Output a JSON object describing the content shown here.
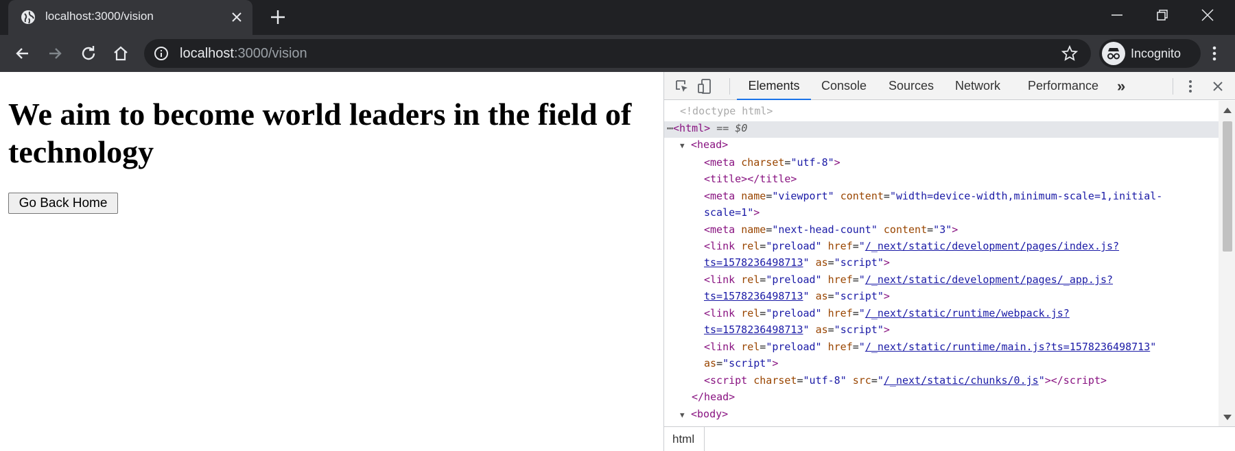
{
  "browser": {
    "tab_title": "localhost:3000/vision",
    "url_host": "localhost",
    "url_rest": ":3000/vision",
    "profile_label": "Incognito",
    "icons": [
      "globe-icon",
      "close-icon",
      "plus-icon",
      "minimize-icon",
      "maximize-icon",
      "window-close-icon",
      "back-arrow-icon",
      "forward-arrow-icon",
      "reload-icon",
      "home-icon",
      "info-icon",
      "star-icon",
      "incognito-icon",
      "kebab-menu-icon"
    ]
  },
  "page": {
    "heading": "We aim to become world leaders in the field of technology",
    "button_label": "Go Back Home"
  },
  "devtools": {
    "tabs": [
      "Elements",
      "Console",
      "Sources",
      "Network",
      "Performance"
    ],
    "active_tab": "Elements",
    "more_tabs": "»",
    "dom": {
      "doctype": "<!doctype html>",
      "html_selected_suffix": "== $0",
      "meta_charset_value": "utf-8",
      "viewport_content_1": "width=device-width,minimum-scale=1,initial-",
      "viewport_content_2": "scale=1",
      "next_head_count": "3",
      "links": [
        {
          "href_1": "/_next/static/development/pages/index.js?",
          "href_2": "ts=1578236498713"
        },
        {
          "href_1": "/_next/static/development/pages/_app.js?",
          "href_2": "ts=1578236498713"
        },
        {
          "href_1": "/_next/static/runtime/webpack.js?",
          "href_2": "ts=1578236498713"
        },
        {
          "href_1": "/_next/static/runtime/main.js?ts=1578236498713"
        }
      ],
      "script_src": "/_next/static/chunks/0.js",
      "as_value": "script"
    },
    "breadcrumb": "html"
  },
  "colors": {
    "chrome_dark": "#202124",
    "chrome_toolbar": "#35363a",
    "devtools_accent": "#1a73e8",
    "tag_color": "#881280",
    "attr_color": "#994500",
    "value_color": "#1a1aa6"
  }
}
